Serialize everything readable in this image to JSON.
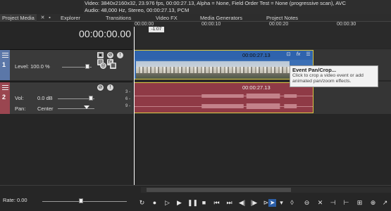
{
  "media_info": {
    "video_line": "Video: 3840x2160x32, 23.976 fps, 00:00:27.13, Alpha = None, Field Order Test = None (progressive scan), AVC",
    "audio_line": "Audio: 48,000 Hz, Stereo, 00:00:27.13, PCM"
  },
  "tabs": [
    {
      "label": "Project Media"
    },
    {
      "label": "Explorer"
    },
    {
      "label": "Transitions"
    },
    {
      "label": "Video FX"
    },
    {
      "label": "Media Generators"
    },
    {
      "label": "Project Notes"
    }
  ],
  "timecode": "00:00:00.00",
  "ruler": {
    "marker": "-1:07",
    "ticks": [
      "00:00:00",
      "00:00:10",
      "00:00:20",
      "00:00:30"
    ]
  },
  "video_track": {
    "number": "1",
    "level_label": "Level: 100.0 %",
    "level": 1.0,
    "event_time": "00:00:27.13"
  },
  "audio_track": {
    "number": "2",
    "vol_label": "Vol:",
    "vol_value": "0.0 dB",
    "pan_label": "Pan:",
    "pan_value": "Center",
    "event_time": "00:00:27.13",
    "db_scale": [
      "3 -",
      "6 -",
      "9 -"
    ]
  },
  "tooltip": {
    "title": "Event Pan/Crop...",
    "body": "Click to crop a video event or add animated pan/zoom effects."
  },
  "rate_label": "Rate: 0.00",
  "rate": 0.0,
  "transport": {
    "icons": [
      "loop-icon",
      "record-icon",
      "play-from-start-icon",
      "play-icon",
      "pause-icon",
      "stop-icon",
      "prev-frame-icon",
      "go-start-icon",
      "go-end-icon",
      "prev-edit-icon",
      "next-edit-icon",
      "rewind-icon",
      "normal-edit-tool-icon",
      "envelope-edit-tool-icon",
      "split-tool-icon",
      "delete-icon",
      "trim-start-icon",
      "trim-end-icon",
      "ripple-icon"
    ],
    "active": "normal-edit-tool-icon"
  },
  "colors": {
    "video_accent": "#5b77a8",
    "audio_accent": "#9a4650",
    "event_border": "#d8c640",
    "video_event": "#3b6fb5",
    "audio_event": "#8f3a46"
  }
}
